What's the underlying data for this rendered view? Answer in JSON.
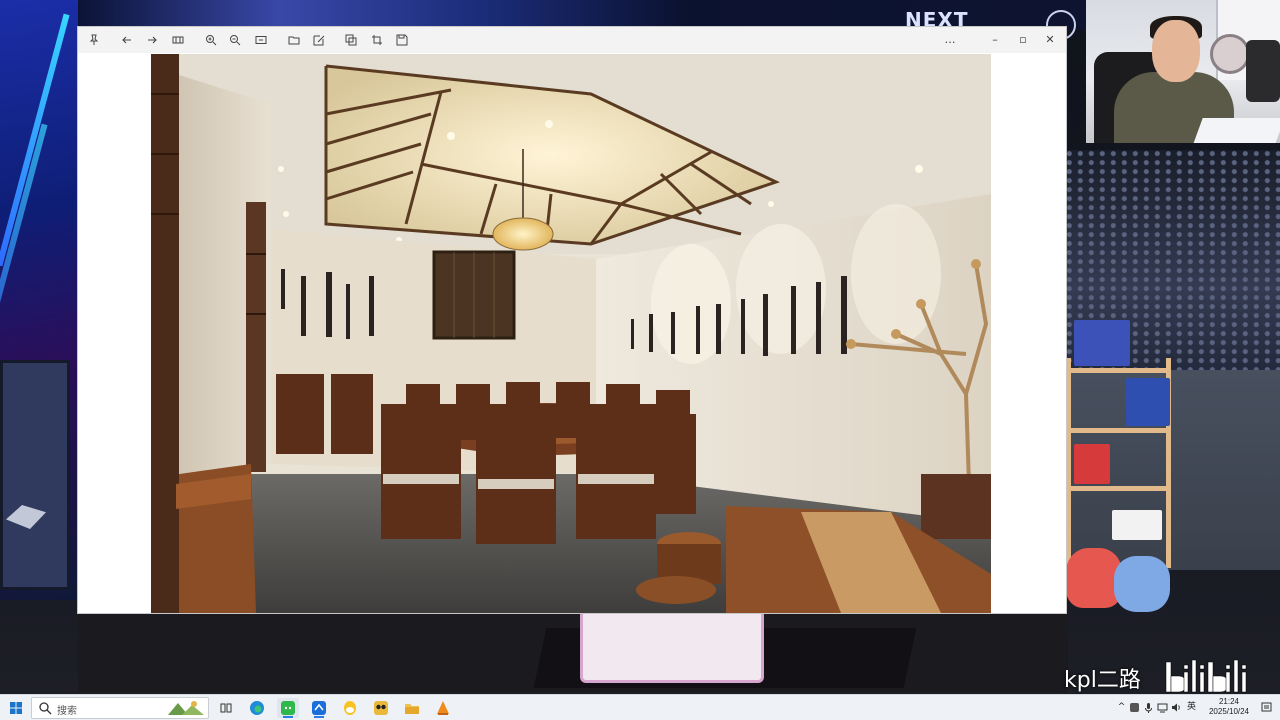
{
  "stream": {
    "next_banner": "NEXT",
    "channel_mark": "kpl二路",
    "logo_text": "bilibili"
  },
  "viewer": {
    "toolbar_left": [
      {
        "name": "pin-icon",
        "glyph": "pin"
      },
      {
        "name": "back-arrow-icon",
        "glyph": "back"
      },
      {
        "name": "forward-arrow-icon",
        "glyph": "forward"
      },
      {
        "name": "gallery-icon",
        "glyph": "grid"
      },
      {
        "name": "zoom-in-icon",
        "glyph": "zoom-in"
      },
      {
        "name": "zoom-out-icon",
        "glyph": "zoom-out"
      },
      {
        "name": "fit-screen-icon",
        "glyph": "fit"
      },
      {
        "name": "open-folder-icon",
        "glyph": "folder"
      },
      {
        "name": "edit-icon",
        "glyph": "edit"
      },
      {
        "name": "copy-icon",
        "glyph": "copy"
      },
      {
        "name": "crop-icon",
        "glyph": "crop"
      },
      {
        "name": "save-icon",
        "glyph": "save"
      }
    ],
    "toolbar_right": {
      "more": "…",
      "minimize": "–",
      "maximize": "▫",
      "close": "✕"
    },
    "image_subject": "chinese-private-dining-room"
  },
  "taskbar": {
    "search_placeholder": "搜索",
    "apps": [
      {
        "name": "task-view-icon",
        "active": false
      },
      {
        "name": "edge-browser-icon",
        "active": false
      },
      {
        "name": "wechat-icon",
        "active": true
      },
      {
        "name": "tencent-meeting-icon",
        "active": true
      },
      {
        "name": "qq-icon",
        "active": false
      },
      {
        "name": "owl-app-icon",
        "active": false
      },
      {
        "name": "file-explorer-icon",
        "active": false
      },
      {
        "name": "vlc-icon",
        "active": false
      }
    ],
    "tray": {
      "input_method": "英",
      "time": "21:24",
      "date": "2025/10/24"
    }
  },
  "colors": {
    "taskbar_bg": "#eef1f6",
    "accent": "#2a7de1",
    "viewer_toolbar": "#f3f3f3"
  }
}
